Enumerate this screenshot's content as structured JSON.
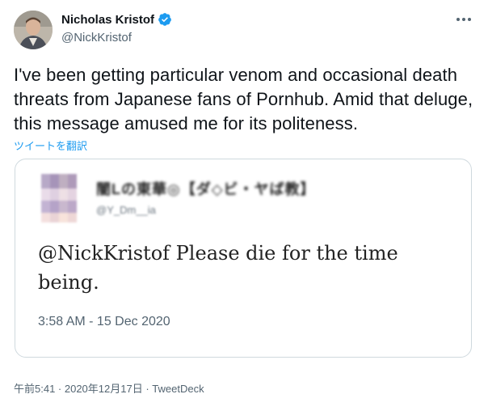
{
  "author": {
    "display_name": "Nicholas Kristof",
    "handle": "@NickKristof",
    "verified": true
  },
  "tweet": {
    "text": "I've been getting particular venom and occasional death threats from Japanese fans of Pornhub. Amid that deluge, this message amused me for its politeness.",
    "translate_label": "ツイートを翻訳"
  },
  "quoted": {
    "name_obscured": "闇Lの東華◎【ダ◇ビ・ヤば教】",
    "handle_obscured": "@Y_Dm__ia",
    "text": "@NickKristof Please die for the time being.",
    "timestamp": "3:58 AM - 15 Dec 2020"
  },
  "meta": {
    "timestamp": "午前5:41 · 2020年12月17日",
    "separator": " · ",
    "source": "TweetDeck"
  },
  "colors": {
    "verified": "#1d9bf0",
    "link": "#1d9bf0",
    "border": "#cfd9de"
  }
}
